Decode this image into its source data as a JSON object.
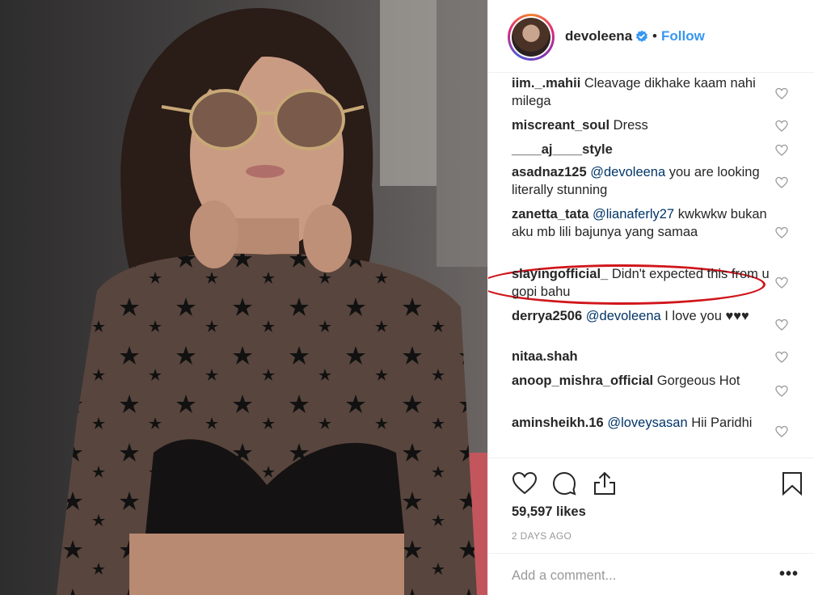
{
  "post": {
    "username": "devoleena",
    "verified": true,
    "separator": "•",
    "follow_label": "Follow",
    "likes": "59,597 likes",
    "time": "2 DAYS AGO",
    "add_comment_placeholder": "Add a comment...",
    "more_label": "•••"
  },
  "comments": [
    {
      "user": "iim._.mahii",
      "parts": [
        {
          "t": "Cleavage dikhake kaam nahi milega"
        }
      ]
    },
    {
      "user": "miscreant_soul",
      "parts": [
        {
          "t": "Dress"
        }
      ]
    },
    {
      "user": "____aj____style",
      "parts": [
        {
          "t": ""
        }
      ]
    },
    {
      "user": "asadnaz125",
      "parts": [
        {
          "m": "@devoleena"
        },
        {
          "t": " you are looking literally stunning"
        }
      ]
    },
    {
      "user": "zanetta_tata",
      "parts": [
        {
          "m": "@lianaferly27"
        },
        {
          "t": " kwkwkw bukan aku mb lili bajunya yang samaa"
        }
      ]
    },
    {
      "user": "slayingofficial_",
      "parts": [
        {
          "t": "Didn't expected this from u gopi bahu"
        }
      ]
    },
    {
      "user": "derrya2506",
      "parts": [
        {
          "m": "@devoleena"
        },
        {
          "t": " I love you ♥♥♥"
        }
      ]
    },
    {
      "user": "nitaa.shah",
      "parts": [
        {
          "t": ""
        }
      ]
    },
    {
      "user": "anoop_mishra_official",
      "parts": [
        {
          "t": "Gorgeous Hot"
        }
      ]
    },
    {
      "user": "aminsheikh.16",
      "parts": [
        {
          "m": "@loveysasan"
        },
        {
          "t": " Hii Paridhi"
        }
      ]
    }
  ],
  "colors": {
    "link_blue": "#3897f0",
    "mention_blue": "#003569",
    "annotation_red": "#d0161b",
    "muted": "#999999"
  },
  "icons": [
    "verified-badge-icon",
    "heart-icon",
    "comment-icon",
    "share-icon",
    "bookmark-icon",
    "more-options-icon"
  ]
}
